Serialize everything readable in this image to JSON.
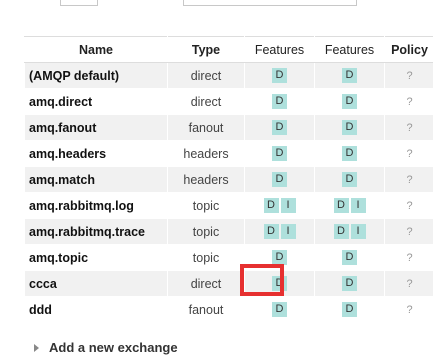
{
  "headers": {
    "name": "Name",
    "type": "Type",
    "features1": "Features",
    "features2": "Features",
    "policy": "Policy"
  },
  "exchanges": [
    {
      "name": "(AMQP default)",
      "type": "direct",
      "features1": [
        "D"
      ],
      "features2": [
        "D"
      ],
      "policy": "?"
    },
    {
      "name": "amq.direct",
      "type": "direct",
      "features1": [
        "D"
      ],
      "features2": [
        "D"
      ],
      "policy": "?"
    },
    {
      "name": "amq.fanout",
      "type": "fanout",
      "features1": [
        "D"
      ],
      "features2": [
        "D"
      ],
      "policy": "?"
    },
    {
      "name": "amq.headers",
      "type": "headers",
      "features1": [
        "D"
      ],
      "features2": [
        "D"
      ],
      "policy": "?"
    },
    {
      "name": "amq.match",
      "type": "headers",
      "features1": [
        "D"
      ],
      "features2": [
        "D"
      ],
      "policy": "?"
    },
    {
      "name": "amq.rabbitmq.log",
      "type": "topic",
      "features1": [
        "D",
        "I"
      ],
      "features2": [
        "D",
        "I"
      ],
      "policy": "?"
    },
    {
      "name": "amq.rabbitmq.trace",
      "type": "topic",
      "features1": [
        "D",
        "I"
      ],
      "features2": [
        "D",
        "I"
      ],
      "policy": "?"
    },
    {
      "name": "amq.topic",
      "type": "topic",
      "features1": [
        "D"
      ],
      "features2": [
        "D"
      ],
      "policy": "?"
    },
    {
      "name": "ccca",
      "type": "direct",
      "features1": [
        "D"
      ],
      "features2": [
        "D"
      ],
      "policy": "?"
    },
    {
      "name": "ddd",
      "type": "fanout",
      "features1": [
        "D"
      ],
      "features2": [
        "D"
      ],
      "policy": "?"
    }
  ],
  "add_exchange": {
    "label": "Add a new exchange",
    "icon": "triangle-right-icon"
  },
  "colors": {
    "badge": "#aee0dc",
    "highlight": "#e63030",
    "row_alt": "#f1f1f1"
  }
}
